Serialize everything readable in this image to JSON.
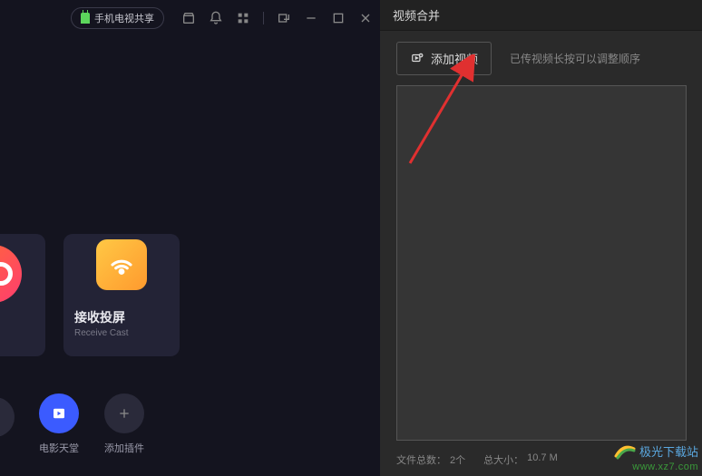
{
  "left": {
    "share_badge": "手机电视共享",
    "card": {
      "title": "接收投屏",
      "subtitle": "Receive Cast"
    },
    "bottom": {
      "cinema": "电影天堂",
      "add_plugin": "添加插件"
    }
  },
  "right": {
    "title": "视频合并",
    "add_button": "添加视频",
    "hint": "已传视频长按可以调整顺序",
    "status": {
      "file_count_label": "文件总数：",
      "file_count_value": "2个",
      "total_size_label": "总大小：",
      "total_size_value": "10.7 M"
    }
  },
  "watermark": {
    "name": "极光下载站",
    "url": "www.xz7.com"
  }
}
